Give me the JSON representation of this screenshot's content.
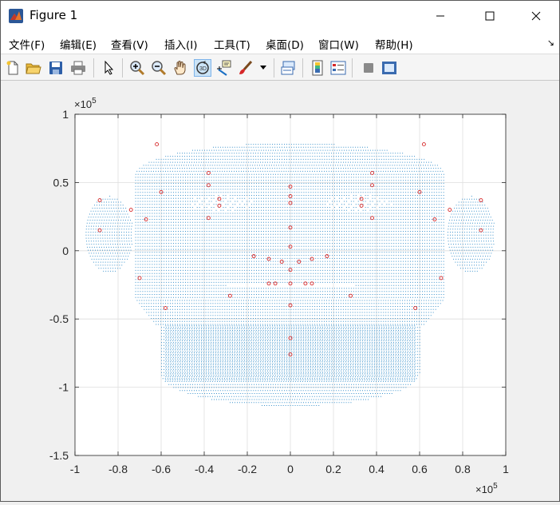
{
  "window": {
    "title": "Figure 1",
    "minimize_label": "minimize",
    "maximize_label": "maximize",
    "close_label": "close"
  },
  "menu": {
    "items": [
      {
        "label": "文件(F)"
      },
      {
        "label": "编辑(E)"
      },
      {
        "label": "查看(V)"
      },
      {
        "label": "插入(I)"
      },
      {
        "label": "工具(T)"
      },
      {
        "label": "桌面(D)"
      },
      {
        "label": "窗口(W)"
      },
      {
        "label": "帮助(H)"
      }
    ],
    "corner_glyph": "↘"
  },
  "toolbar": {
    "buttons": [
      {
        "icon": "new-figure-icon"
      },
      {
        "icon": "open-file-icon"
      },
      {
        "icon": "save-icon"
      },
      {
        "icon": "print-icon"
      },
      {
        "icon": "edit-plot-arrow-icon"
      },
      {
        "icon": "zoom-in-icon"
      },
      {
        "icon": "zoom-out-icon"
      },
      {
        "icon": "pan-hand-icon"
      },
      {
        "icon": "rotate-3d-icon",
        "active": true
      },
      {
        "icon": "data-cursor-icon"
      },
      {
        "icon": "brush-icon"
      },
      {
        "icon": "link-plot-icon"
      },
      {
        "icon": "colorbar-icon"
      },
      {
        "icon": "legend-icon"
      },
      {
        "icon": "hide-plot-tools-icon"
      },
      {
        "icon": "show-plot-tools-icon"
      }
    ],
    "accent": "#0072bd"
  },
  "chart_data": {
    "type": "scatter",
    "title": "",
    "xlabel": "",
    "ylabel": "",
    "xlim": [
      -1,
      1
    ],
    "ylim": [
      -1.5,
      1
    ],
    "x_exponent_label": "×10",
    "x_exponent_power": "5",
    "y_exponent_label": "×10",
    "y_exponent_power": "5",
    "x_ticks": [
      "-1",
      "-0.8",
      "-0.6",
      "-0.4",
      "-0.2",
      "0",
      "0.2",
      "0.4",
      "0.6",
      "0.8",
      "1"
    ],
    "x_tick_values": [
      -1,
      -0.8,
      -0.6,
      -0.4,
      -0.2,
      0,
      0.2,
      0.4,
      0.6,
      0.8,
      1
    ],
    "y_ticks": [
      "1",
      "0.5",
      "0",
      "-0.5",
      "-1",
      "-1.5"
    ],
    "y_tick_values": [
      1,
      0.5,
      0,
      -0.5,
      -1,
      -1.5
    ],
    "grid": true,
    "series": [
      {
        "color": "#0072bd",
        "marker": "dot",
        "points": [
          [
            -0.7,
            0.62
          ],
          [
            -0.5,
            0.72
          ],
          [
            -0.3,
            0.78
          ],
          [
            0,
            0.8
          ],
          [
            0.3,
            0.78
          ],
          [
            0.5,
            0.72
          ],
          [
            0.7,
            0.62
          ],
          [
            -0.78,
            0.3
          ],
          [
            0.78,
            0.3
          ],
          [
            -0.8,
            0.0
          ],
          [
            0.8,
            0.0
          ],
          [
            -0.75,
            -0.2
          ],
          [
            0.75,
            -0.2
          ],
          [
            -0.6,
            -0.45
          ],
          [
            0.6,
            -0.45
          ],
          [
            -0.55,
            -0.9
          ],
          [
            0.55,
            -0.9
          ],
          [
            -0.3,
            -1.05
          ],
          [
            0,
            -1.12
          ],
          [
            0.3,
            -1.05
          ],
          [
            -0.9,
            0.35
          ],
          [
            -0.85,
            0.1
          ],
          [
            0.9,
            0.35
          ],
          [
            0.85,
            0.1
          ],
          [
            0,
            0.3
          ],
          [
            0,
            -0.5
          ],
          [
            -0.3,
            0.35
          ],
          [
            0.3,
            0.35
          ]
        ]
      },
      {
        "color": "#d62728",
        "marker": "circle",
        "points": [
          [
            -0.885,
            0.37
          ],
          [
            -0.885,
            0.15
          ],
          [
            -0.74,
            0.3
          ],
          [
            -0.67,
            0.23
          ],
          [
            -0.6,
            0.43
          ],
          [
            -0.58,
            -0.42
          ],
          [
            -0.7,
            -0.2
          ],
          [
            -0.38,
            0.57
          ],
          [
            -0.38,
            0.48
          ],
          [
            -0.33,
            0.38
          ],
          [
            -0.33,
            0.33
          ],
          [
            -0.38,
            0.24
          ],
          [
            0.38,
            0.57
          ],
          [
            0.38,
            0.48
          ],
          [
            0.33,
            0.38
          ],
          [
            0.33,
            0.33
          ],
          [
            0.38,
            0.24
          ],
          [
            0.6,
            0.43
          ],
          [
            0.67,
            0.23
          ],
          [
            0.74,
            0.3
          ],
          [
            0.885,
            0.37
          ],
          [
            0.885,
            0.15
          ],
          [
            0.58,
            -0.42
          ],
          [
            0.7,
            -0.2
          ],
          [
            0,
            0.47
          ],
          [
            0,
            0.4
          ],
          [
            0,
            0.35
          ],
          [
            0,
            0.17
          ],
          [
            0,
            0.03
          ],
          [
            0,
            -0.14
          ],
          [
            0,
            -0.24
          ],
          [
            0,
            -0.4
          ],
          [
            0,
            -0.64
          ],
          [
            0,
            -0.76
          ],
          [
            -0.17,
            -0.04
          ],
          [
            -0.1,
            -0.06
          ],
          [
            -0.04,
            -0.08
          ],
          [
            0.04,
            -0.08
          ],
          [
            0.1,
            -0.06
          ],
          [
            0.17,
            -0.04
          ],
          [
            -0.28,
            -0.33
          ],
          [
            -0.1,
            -0.24
          ],
          [
            -0.07,
            -0.24
          ],
          [
            0.07,
            -0.24
          ],
          [
            0.1,
            -0.24
          ],
          [
            0.28,
            -0.33
          ],
          [
            -0.62,
            0.78
          ],
          [
            0.62,
            0.78
          ]
        ]
      }
    ]
  }
}
